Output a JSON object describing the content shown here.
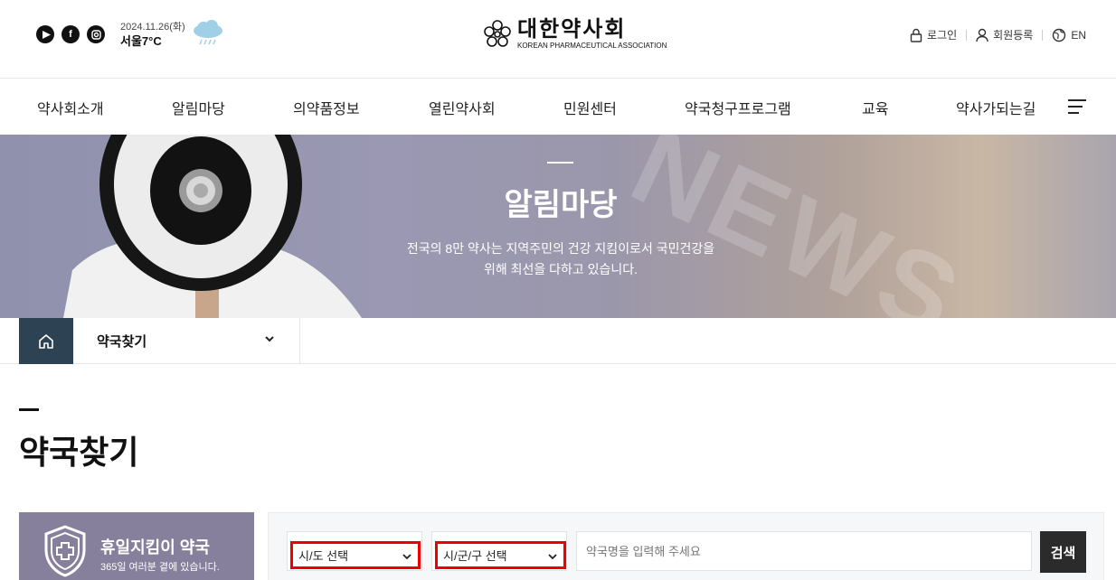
{
  "header": {
    "social": [
      {
        "icon": "youtube-icon",
        "glyph": "▶"
      },
      {
        "icon": "facebook-icon",
        "glyph": "f"
      },
      {
        "icon": "instagram-icon",
        "glyph": "◎"
      }
    ],
    "date": "2024.11.26(화)",
    "weather_text": "서울7°C",
    "weather_icon": "rain-cloud-icon",
    "logo_ko": "대한약사회",
    "logo_en": "KOREAN PHARMACEUTICAL ASSOCIATION",
    "login": "로그인",
    "register": "회원등록",
    "lang": "EN"
  },
  "nav": {
    "items": [
      "약사회소개",
      "알림마당",
      "의약품정보",
      "열린약사회",
      "민원센터",
      "약국청구프로그램",
      "교육",
      "약사가되는길"
    ]
  },
  "hero": {
    "title": "알림마당",
    "desc_line1": "전국의 8만 약사는 지역주민의 건강 지킴이로서 국민건강을",
    "desc_line2": "위해 최선을 다하고 있습니다."
  },
  "breadcrumb": {
    "current": "약국찾기"
  },
  "page": {
    "title": "약국찾기"
  },
  "holiday": {
    "title": "휴일지킴이 약국",
    "subtitle": "365일 여러분 곁에 있습니다."
  },
  "search": {
    "sido": "시/도 선택",
    "sigungu": "시/군/구 선택",
    "placeholder": "약국명을 입력해 주세요",
    "button": "검색"
  },
  "colors": {
    "accent_dark": "#2d4253",
    "holiday_bg": "#86809c",
    "highlight_border": "#ee0000"
  }
}
